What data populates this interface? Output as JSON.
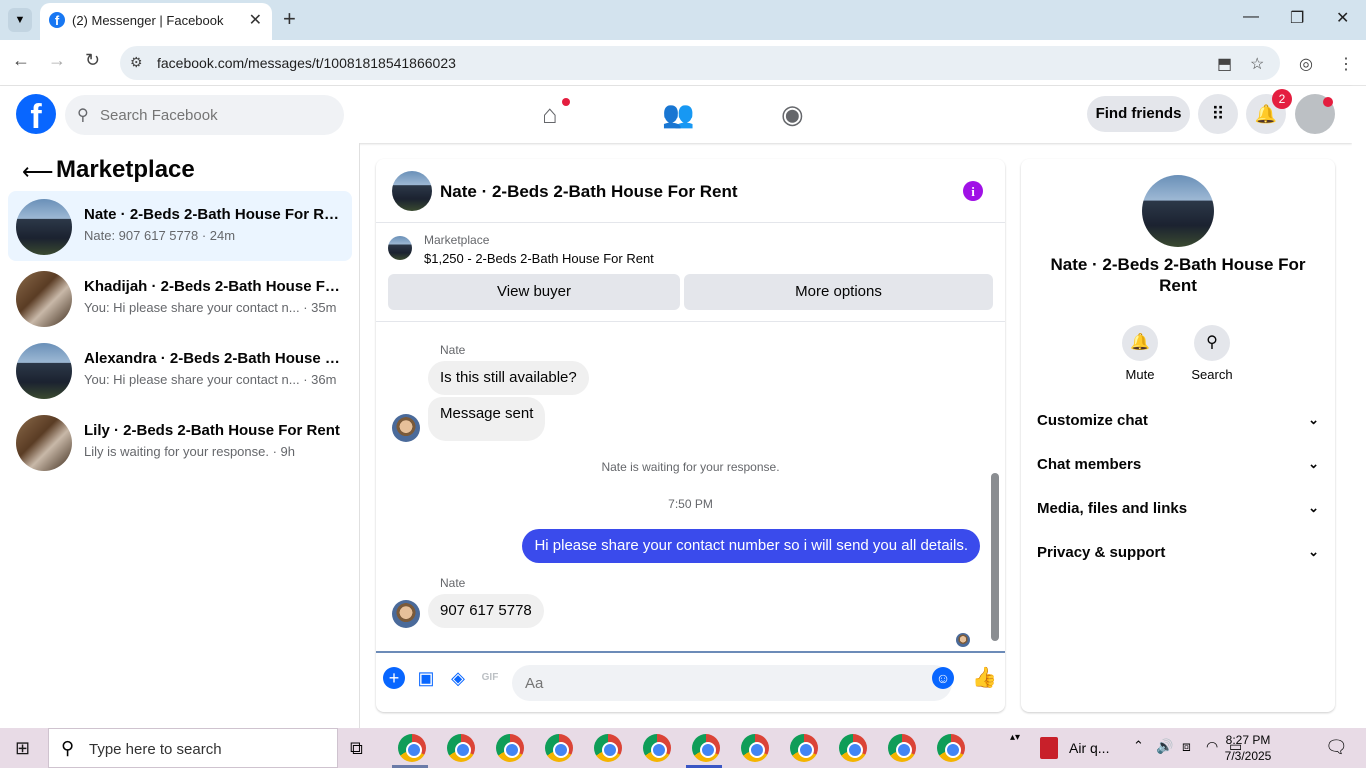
{
  "browser": {
    "tab_title": "(2) Messenger | Facebook",
    "url": "facebook.com/messages/t/10081818541866023"
  },
  "fb": {
    "logo": "f",
    "search_placeholder": "Search Facebook",
    "find_friends": "Find friends",
    "notif_count": "2"
  },
  "sidebar": {
    "title": "Marketplace",
    "conversations": [
      {
        "name": "Nate · 2-Beds 2-Bath House For Re...",
        "preview": "Nate: 907 617 5778 · 24m"
      },
      {
        "name": "Khadijah · 2-Beds 2-Bath House Fo...",
        "preview": "You: Hi please share your contact n... · 35m"
      },
      {
        "name": "Alexandra · 2-Beds 2-Bath House F...",
        "preview": "You: Hi please share your contact n... · 36m"
      },
      {
        "name": "Lily · 2-Beds 2-Bath House For Rent",
        "preview": "Lily is waiting for your response. · 9h"
      }
    ]
  },
  "chat": {
    "title": "Nate · 2-Beds 2-Bath House For Rent",
    "info": "i",
    "listing": {
      "label": "Marketplace",
      "price_title": "$1,250 - 2-Beds 2-Bath House For Rent"
    },
    "view_buyer": "View buyer",
    "more_options": "More options",
    "messages": {
      "sender1": "Nate",
      "msg1": "Is this still available?",
      "msg2": "Message sent",
      "waiting": "Nate is waiting for your response.",
      "time": "7:50 PM",
      "me": "Hi please share your contact number so i will send you all details.",
      "sender2": "Nate",
      "msg3": "907 617 5778"
    },
    "input_placeholder": "Aa"
  },
  "right": {
    "name": "Nate · 2-Beds 2-Bath House For Rent",
    "mute": "Mute",
    "search": "Search",
    "sections": [
      "Customize chat",
      "Chat members",
      "Media, files and links",
      "Privacy & support"
    ]
  },
  "taskbar": {
    "search": "Type here to search",
    "weather": "Air q...",
    "time": "8:27 PM",
    "date": "7/3/2025"
  },
  "colors": {
    "accent": "#0866ff",
    "my_bubble": "#3a4bec",
    "badge": "#e41e3f"
  }
}
